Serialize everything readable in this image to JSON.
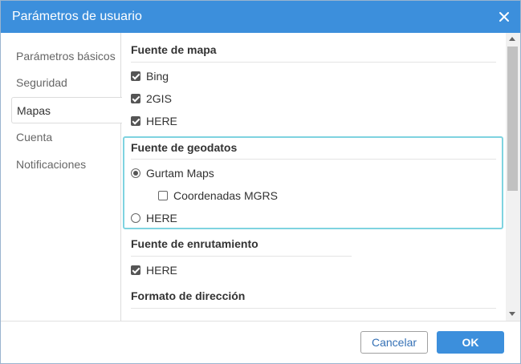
{
  "window": {
    "title": "Parámetros de usuario",
    "close_icon": "close-icon"
  },
  "sidebar": {
    "items": [
      {
        "label": "Parámetros básicos"
      },
      {
        "label": "Seguridad"
      },
      {
        "label": "Mapas",
        "active": true
      },
      {
        "label": "Cuenta"
      },
      {
        "label": "Notificaciones"
      }
    ]
  },
  "main": {
    "map_source": {
      "title": "Fuente de mapa",
      "options": [
        {
          "label": "Bing",
          "checked": true
        },
        {
          "label": "2GIS",
          "checked": true
        },
        {
          "label": "HERE",
          "checked": true
        }
      ]
    },
    "geodata_source": {
      "title": "Fuente de geodatos",
      "options": [
        {
          "label": "Gurtam Maps",
          "selected": true
        },
        {
          "label": "HERE",
          "selected": false
        }
      ],
      "sub_option": {
        "label": "Coordenadas MGRS",
        "checked": false
      }
    },
    "routing_source": {
      "title": "Fuente de enrutamiento",
      "options": [
        {
          "label": "HERE",
          "checked": true
        }
      ]
    },
    "address_format": {
      "title": "Formato de dirección"
    }
  },
  "footer": {
    "cancel_label": "Cancelar",
    "ok_label": "OK"
  },
  "colors": {
    "accent": "#3c8fdc",
    "highlight": "#7fd3e0"
  }
}
